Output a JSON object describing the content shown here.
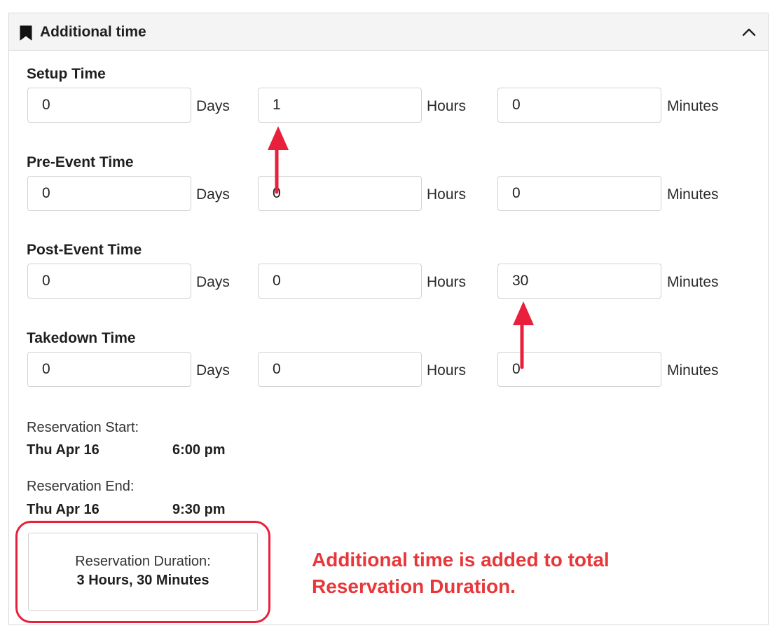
{
  "panel": {
    "title": "Additional time",
    "collapse_icon": "chevron-up-icon",
    "title_icon": "bookmark-icon"
  },
  "units": {
    "days": "Days",
    "hours": "Hours",
    "minutes": "Minutes"
  },
  "groups": [
    {
      "label": "Setup Time",
      "days": "0",
      "hours": "1",
      "minutes": "0"
    },
    {
      "label": "Pre-Event Time",
      "days": "0",
      "hours": "0",
      "minutes": "0"
    },
    {
      "label": "Post-Event Time",
      "days": "0",
      "hours": "0",
      "minutes": "30"
    },
    {
      "label": "Takedown Time",
      "days": "0",
      "hours": "0",
      "minutes": "0"
    }
  ],
  "reservation": {
    "start_label": "Reservation Start:",
    "start_date": "Thu Apr 16",
    "start_time": "6:00 pm",
    "end_label": "Reservation End:",
    "end_date": "Thu Apr 16",
    "end_time": "9:30 pm",
    "duration_label": "Reservation Duration:",
    "duration_value": "3 Hours, 30 Minutes"
  },
  "annotation": {
    "line1": "Additional time is added to total",
    "line2": "Reservation Duration."
  },
  "colors": {
    "annotation": "#e8373a",
    "highlight_border": "#e8203c",
    "arrow": "#e8203c"
  }
}
